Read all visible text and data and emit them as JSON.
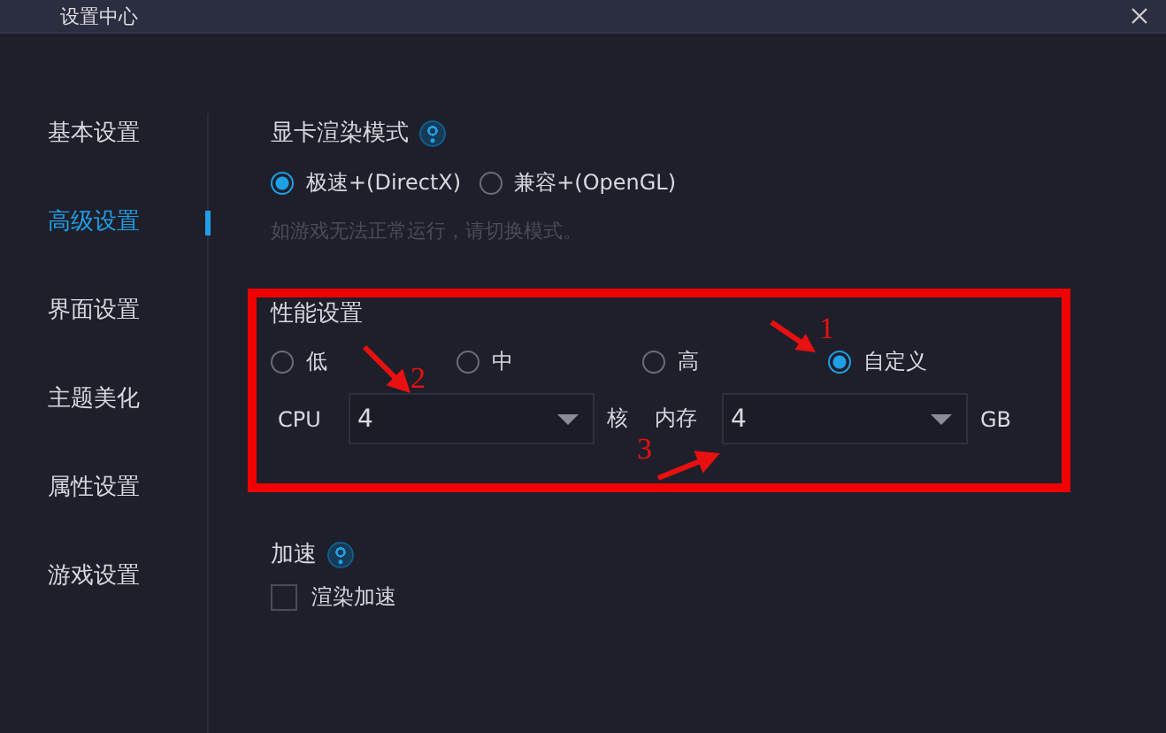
{
  "window": {
    "title": "设置中心"
  },
  "sidebar": {
    "items": [
      {
        "label": "基本设置",
        "selected": false
      },
      {
        "label": "高级设置",
        "selected": true
      },
      {
        "label": "界面设置",
        "selected": false
      },
      {
        "label": "主题美化",
        "selected": false
      },
      {
        "label": "属性设置",
        "selected": false
      },
      {
        "label": "游戏设置",
        "selected": false
      }
    ]
  },
  "render_mode": {
    "title": "显卡渲染模式",
    "options": [
      {
        "label": "极速+(DirectX)",
        "selected": true
      },
      {
        "label": "兼容+(OpenGL)",
        "selected": false
      }
    ],
    "hint": "如游戏无法正常运行，请切换模式。"
  },
  "performance": {
    "title": "性能设置",
    "highlighted": true,
    "options": [
      {
        "label": "低",
        "selected": false
      },
      {
        "label": "中",
        "selected": false
      },
      {
        "label": "高",
        "selected": false
      },
      {
        "label": "自定义",
        "selected": true
      }
    ],
    "cpu": {
      "label": "CPU",
      "value": "4",
      "unit": "核"
    },
    "memory": {
      "label": "内存",
      "value": "4",
      "unit": "GB"
    }
  },
  "acceleration": {
    "title": "加速",
    "options": [
      {
        "label": "渲染加速",
        "checked": false
      }
    ]
  },
  "annotations": [
    {
      "label": "1"
    },
    {
      "label": "2"
    },
    {
      "label": "3"
    }
  ]
}
